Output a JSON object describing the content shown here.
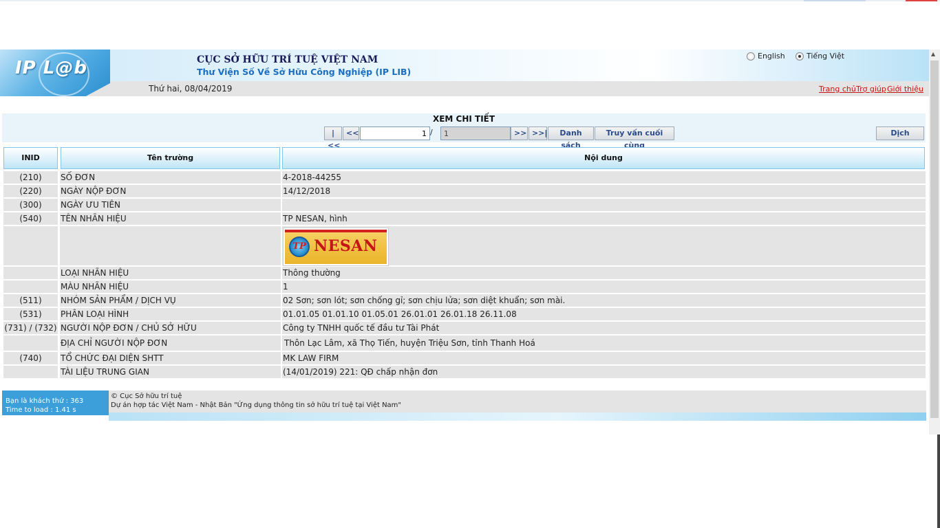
{
  "header": {
    "logo_text": "IP L@b",
    "org_title": "CỤC SỞ HỮU TRÍ TUỆ VIỆT NAM",
    "org_subtitle": "Thư Viện Số Về Sở Hữu Công Nghiệp (IP LIB)",
    "lang_options": [
      "English",
      "Tiếng Việt"
    ],
    "lang_selected": "Tiếng Việt",
    "date": "Thứ hai, 08/04/2019",
    "links": [
      "Trang chủ",
      "Trợ giúp",
      "Giới thiệu"
    ]
  },
  "nav": {
    "title": "XEM CHI TIẾT",
    "first": "|<<",
    "prev": "<<",
    "current_page": "1",
    "slash": "/",
    "total_pages": "1",
    "next": ">>",
    "last": ">>|",
    "list_label": "Danh sách",
    "last_query_label": "Truy vấn cuối cùng",
    "translate_label": "Dịch"
  },
  "table": {
    "headers": [
      "INID",
      "Tên trường",
      "Nội dung"
    ],
    "rows": [
      {
        "inid": "(210)",
        "label": "SỐ ĐƠN",
        "value": "4-2018-44255"
      },
      {
        "inid": "(220)",
        "label": "NGÀY NỘP ĐƠN",
        "value": "14/12/2018"
      },
      {
        "inid": "(300)",
        "label": "NGÀY ƯU TIÊN",
        "value": ""
      },
      {
        "inid": "(540)",
        "label": "TÊN NHÃN HIỆU",
        "value": "TP NESAN, hình"
      },
      {
        "inid": "",
        "label": "",
        "value": ""
      },
      {
        "inid": "",
        "label": "LOẠI NHÃN HIỆU",
        "value": "Thông thường"
      },
      {
        "inid": "",
        "label": "MÀU NHÃN HIỆU",
        "value": "1"
      },
      {
        "inid": "(511)",
        "label": "NHÓM SẢN PHẨM / DỊCH VỤ",
        "value": "02 Sơn; sơn lót; sơn chống gỉ; sơn chịu lửa; sơn diệt khuẩn; sơn mài."
      },
      {
        "inid": "(531)",
        "label": "PHÂN LOẠI HÌNH",
        "value": "01.01.05 01.01.10 01.05.01 26.01.01 26.01.18 26.11.08"
      },
      {
        "inid": "(731) / (732)",
        "label": "NGƯỜI NỘP ĐƠN / CHỦ SỞ HỮU",
        "value": "Công ty TNHH quốc tế đầu tư Tài Phát"
      },
      {
        "inid": "",
        "label": "ĐỊA CHỈ NGƯỜI NỘP ĐƠN",
        "value": "Thôn Lạc Lâm, xã Thọ Tiến, huyện Triệu Sơn, tỉnh Thanh Hoá"
      },
      {
        "inid": "(740)",
        "label": "TỔ CHỨC ĐẠI DIỆN SHTT",
        "value": "MK LAW FIRM"
      },
      {
        "inid": "",
        "label": "TÀI LIỆU TRUNG GIAN",
        "value": "(14/01/2019) 221: QĐ chấp nhận đơn"
      }
    ],
    "mark_image": {
      "badge": "TP",
      "word": "NESAN"
    }
  },
  "footer": {
    "visitor": "Bạn là khách thứ : 363",
    "load_time": "Time to load : 1.41 s",
    "copyright": "© Cục Sở hữu trí tuệ",
    "project": "Dự án hợp tác Việt Nam - Nhật Bản \"Ứng dụng thông tin sở hữu trí tuệ tại Việt Nam\""
  }
}
